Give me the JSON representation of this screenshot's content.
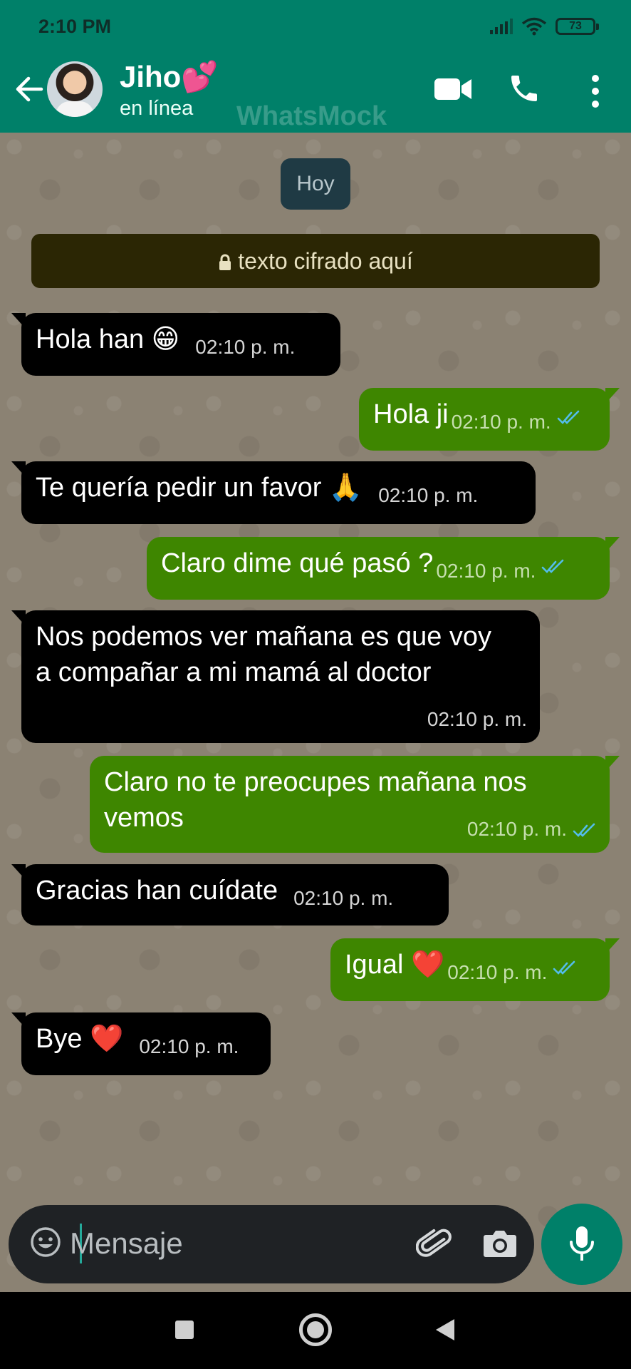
{
  "status_bar": {
    "time": "2:10 PM",
    "battery": "73"
  },
  "header": {
    "contact_name": "Jiho💕",
    "contact_status": "en línea",
    "watermark": "WhatsMock"
  },
  "chat": {
    "date_chip": "Hoy",
    "encryption_notice": "texto cifrado aquí",
    "messages": [
      {
        "direction": "incoming",
        "text": "Hola han 😁",
        "time": "02:10 p. m."
      },
      {
        "direction": "outgoing",
        "text": "Hola ji",
        "time": "02:10 p. m.",
        "status": "read"
      },
      {
        "direction": "incoming",
        "text": "Te quería pedir un favor 🙏",
        "time": "02:10 p. m."
      },
      {
        "direction": "outgoing",
        "text": "Claro dime qué pasó ?",
        "time": "02:10 p. m.",
        "status": "read"
      },
      {
        "direction": "incoming",
        "text": "Nos podemos ver mañana es que voy a compañar a mi mamá al doctor",
        "time": "02:10 p. m."
      },
      {
        "direction": "outgoing",
        "text": "Claro no te preocupes mañana nos vemos",
        "time": "02:10 p. m.",
        "status": "read"
      },
      {
        "direction": "incoming",
        "text": "Gracias han cuídate",
        "time": "02:10 p. m."
      },
      {
        "direction": "outgoing",
        "text": "Igual ❤️",
        "time": "02:10 p. m.",
        "status": "read"
      },
      {
        "direction": "incoming",
        "text": "Bye ❤️",
        "time": "02:10 p. m."
      }
    ]
  },
  "composer": {
    "placeholder": "Mensaje"
  },
  "colors": {
    "header": "#008069",
    "incoming_bubble": "#000000",
    "outgoing_bubble": "#3e8600",
    "read_ticks": "#53bdeb",
    "encryption_bg": "#2b2604"
  }
}
